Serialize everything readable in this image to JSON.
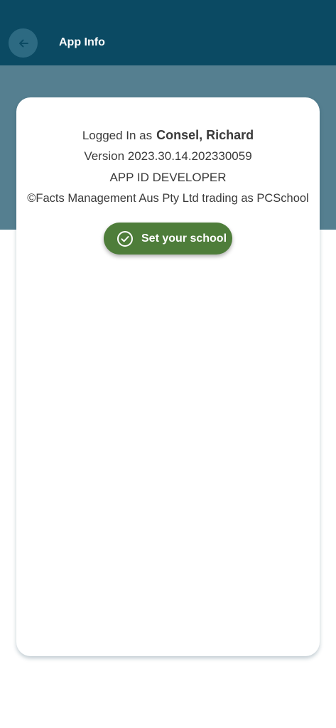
{
  "app_bar": {
    "title": "App Info",
    "back_icon": "arrow-left-icon"
  },
  "info": {
    "logged_in_prefix": "Logged In as",
    "user_name": "Consel, Richard",
    "version": "Version 2023.30.14.202330059",
    "app_id": "APP ID DEVELOPER",
    "copyright": "©Facts Management Aus Pty Ltd trading as PCSchool"
  },
  "school_button": {
    "label": "Set your school",
    "icon": "check-circle-icon"
  },
  "colors": {
    "app_bar": "#0b4a63",
    "header_band": "#557f90",
    "button": "#4e7d3a",
    "text": "#3a3a3a"
  }
}
